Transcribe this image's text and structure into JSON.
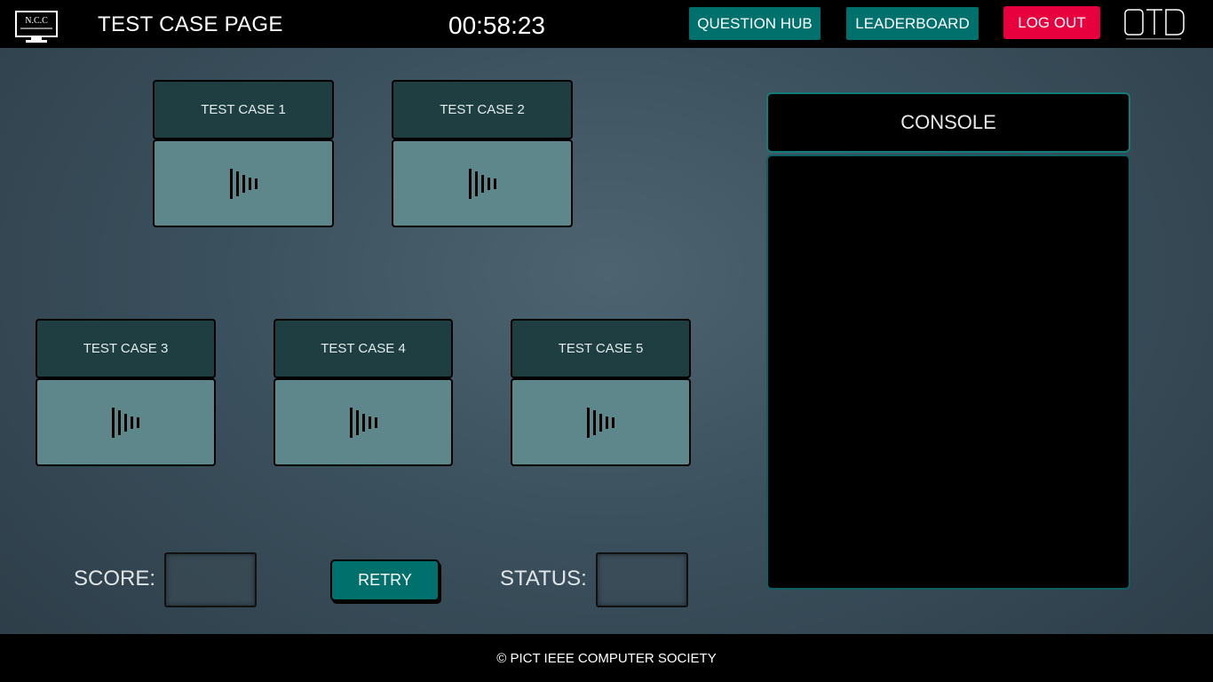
{
  "header": {
    "logo_text": "N.C.C",
    "title": "TEST CASE PAGE",
    "timer": "00:58:23",
    "nav": {
      "question_hub": "QUESTION HUB",
      "leaderboard": "LEADERBOARD",
      "logout": "LOG OUT"
    },
    "logout_color": "#e8003e",
    "accent_color": "#00706d"
  },
  "test_cases": [
    {
      "label": "TEST CASE 1",
      "icon": "loading-bars-icon"
    },
    {
      "label": "TEST CASE 2",
      "icon": "loading-bars-icon"
    },
    {
      "label": "TEST CASE 3",
      "icon": "loading-bars-icon"
    },
    {
      "label": "TEST CASE 4",
      "icon": "loading-bars-icon"
    },
    {
      "label": "TEST CASE 5",
      "icon": "loading-bars-icon"
    }
  ],
  "controls": {
    "score_label": "SCORE:",
    "score_value": "",
    "retry_label": "RETRY",
    "status_label": "STATUS:",
    "status_value": ""
  },
  "console": {
    "title": "CONSOLE",
    "output": ""
  },
  "footer": {
    "text": "© PICT IEEE COMPUTER SOCIETY"
  }
}
